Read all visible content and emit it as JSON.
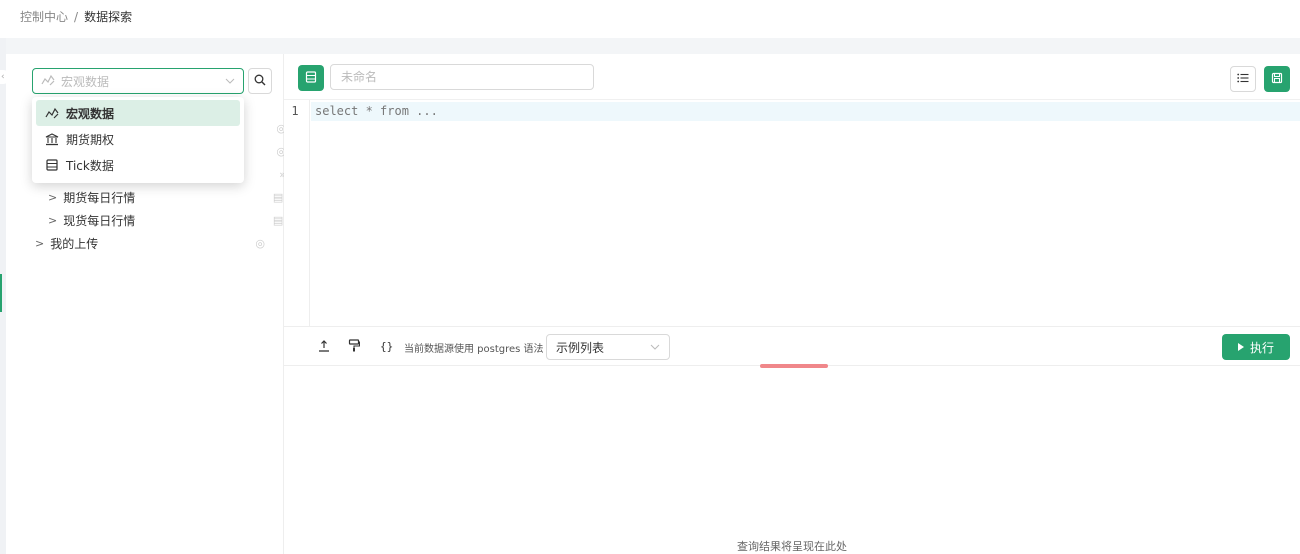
{
  "breadcrumb": {
    "root": "控制中心",
    "separator": "/",
    "current": "数据探索"
  },
  "source_select": {
    "placeholder": "宏观数据",
    "lead_icon": "chart-line-icon",
    "chevron": "chevron-down-icon"
  },
  "dropdown": {
    "options": [
      {
        "label": "宏观数据",
        "icon": "chart-line-icon",
        "selected": true
      },
      {
        "label": "期货期权",
        "icon": "bank-icon",
        "selected": false
      },
      {
        "label": "Tick数据",
        "icon": "table-icon",
        "selected": false
      }
    ]
  },
  "tree": {
    "items": [
      {
        "label": "期货每日行情",
        "level": 1,
        "icons": [
          "table-icon",
          "double-chevron-icon"
        ]
      },
      {
        "label": "现货每日行情",
        "level": 1,
        "icons": [
          "table-icon",
          "double-chevron-icon"
        ]
      },
      {
        "label": "我的上传",
        "level": 0,
        "icons": [
          "eye-icon"
        ]
      }
    ]
  },
  "editor": {
    "name_placeholder": "未命名",
    "line_number": "1",
    "code": "select * from ..."
  },
  "result_toolbar": {
    "syntax_hint": "当前数据源使用 postgres 语法",
    "example_select": "示例列表",
    "run_label": "执行"
  },
  "result": {
    "empty_text": "查询结果将呈现在此处"
  },
  "colors": {
    "accent": "#27a36f",
    "selected_bg": "#dcefe6",
    "drag_bar": "#f0878a"
  }
}
